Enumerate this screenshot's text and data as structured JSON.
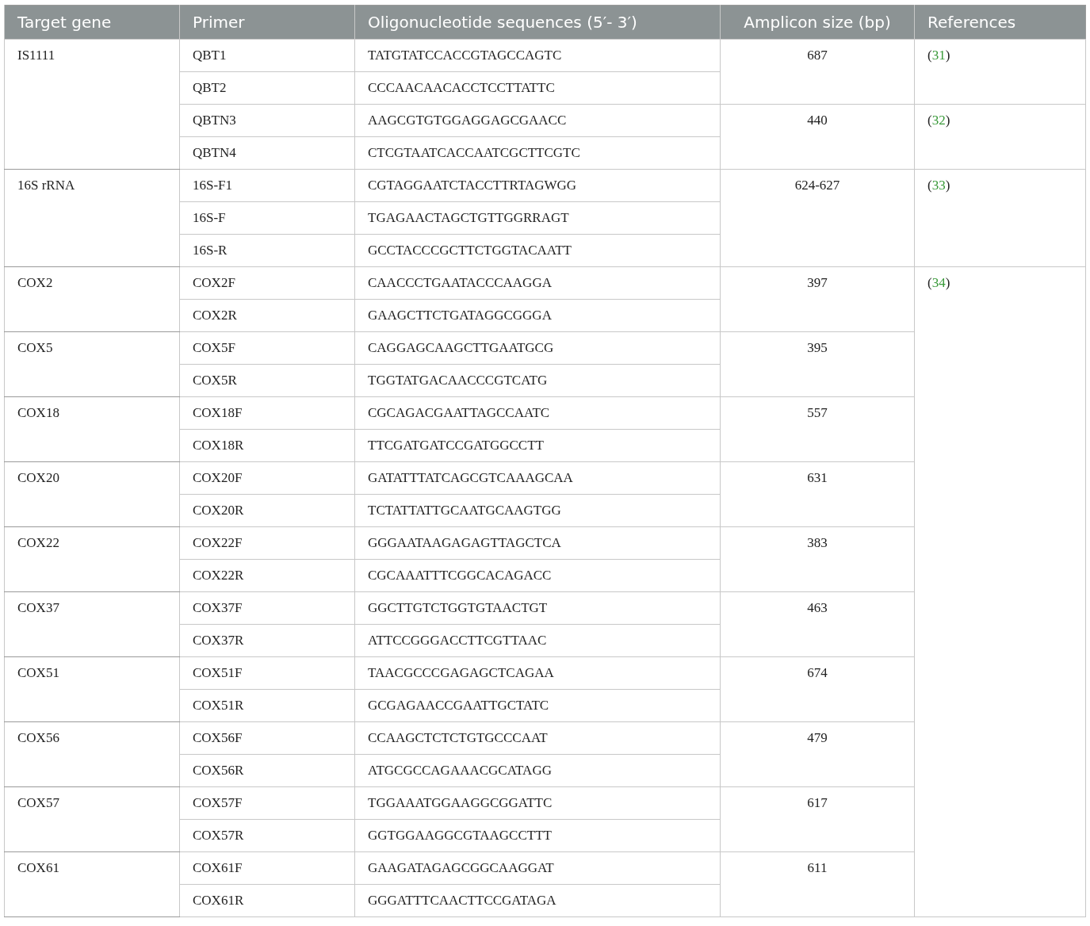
{
  "table": {
    "columns": [
      "Target gene",
      "Primer",
      "Oligonucleotide sequences (5′- 3′)",
      "Amplicon size (bp)",
      "References"
    ],
    "genes": [
      {
        "name": "IS1111",
        "amplicons": [
          {
            "size": "687",
            "reference": {
              "before": "(",
              "link": "31",
              "after": ")"
            },
            "primers": [
              {
                "name": "QBT1",
                "sequence": "TATGTATCCACCGTAGCCAGTC"
              },
              {
                "name": "QBT2",
                "sequence": "CCCAACAACACCTCCTTATTC"
              }
            ]
          },
          {
            "size": "440",
            "reference": {
              "before": "(",
              "link": "32",
              "after": ")"
            },
            "primers": [
              {
                "name": "QBTN3",
                "sequence": "AAGCGTGTGGAGGAGCGAACC"
              },
              {
                "name": "QBTN4",
                "sequence": "CTCGTAATCACCAATCGCTTCGTC"
              }
            ]
          }
        ]
      },
      {
        "name": "16S rRNA",
        "amplicons": [
          {
            "size": "624-627",
            "reference": {
              "before": "(",
              "link": "33",
              "after": ")"
            },
            "primers": [
              {
                "name": "16S-F1",
                "sequence": "CGTAGGAATCTACCTTRTAGWGG"
              },
              {
                "name": "16S-F",
                "sequence": "TGAGAACTAGCTGTTGGRRAGT"
              },
              {
                "name": "16S-R",
                "sequence": "GCCTACCCGCTTCTGGTACAATT"
              }
            ]
          }
        ]
      },
      {
        "name": "COX2",
        "amplicons": [
          {
            "size": "397",
            "reference": {
              "before": "(",
              "link": "34",
              "after": ")"
            },
            "primers": [
              {
                "name": "COX2F",
                "sequence": "CAACCCTGAATACCCAAGGA"
              },
              {
                "name": "COX2R",
                "sequence": "GAAGCTTCTGATAGGCGGGA"
              }
            ]
          }
        ]
      },
      {
        "name": "COX5",
        "amplicons": [
          {
            "size": "395",
            "primers": [
              {
                "name": "COX5F",
                "sequence": "CAGGAGCAAGCTTGAATGCG"
              },
              {
                "name": "COX5R",
                "sequence": "TGGTATGACAACCCGTCATG"
              }
            ]
          }
        ]
      },
      {
        "name": "COX18",
        "amplicons": [
          {
            "size": "557",
            "primers": [
              {
                "name": "COX18F",
                "sequence": "CGCAGACGAATTAGCCAATC"
              },
              {
                "name": "COX18R",
                "sequence": "TTCGATGATCCGATGGCCTT"
              }
            ]
          }
        ]
      },
      {
        "name": "COX20",
        "amplicons": [
          {
            "size": "631",
            "primers": [
              {
                "name": "COX20F",
                "sequence": "GATATTTATCAGCGTCAAAGCAA"
              },
              {
                "name": "COX20R",
                "sequence": "TCTATTATTGCAATGCAAGTGG"
              }
            ]
          }
        ]
      },
      {
        "name": "COX22",
        "amplicons": [
          {
            "size": "383",
            "primers": [
              {
                "name": "COX22F",
                "sequence": "GGGAATAAGAGAGTTAGCTCA"
              },
              {
                "name": "COX22R",
                "sequence": "CGCAAATTTCGGCACAGACC"
              }
            ]
          }
        ]
      },
      {
        "name": "COX37",
        "amplicons": [
          {
            "size": "463",
            "primers": [
              {
                "name": "COX37F",
                "sequence": "GGCTTGTCTGGTGTAACTGT"
              },
              {
                "name": "COX37R",
                "sequence": "ATTCCGGGACCTTCGTTAAC"
              }
            ]
          }
        ]
      },
      {
        "name": "COX51",
        "amplicons": [
          {
            "size": "674",
            "primers": [
              {
                "name": "COX51F",
                "sequence": "TAACGCCCGAGAGCTCAGAA"
              },
              {
                "name": "COX51R",
                "sequence": "GCGAGAACCGAATTGCTATC"
              }
            ]
          }
        ]
      },
      {
        "name": "COX56",
        "amplicons": [
          {
            "size": "479",
            "primers": [
              {
                "name": "COX56F",
                "sequence": "CCAAGCTCTCTGTGCCCAAT"
              },
              {
                "name": "COX56R",
                "sequence": "ATGCGCCAGAAACGCATAGG"
              }
            ]
          }
        ]
      },
      {
        "name": "COX57",
        "amplicons": [
          {
            "size": "617",
            "primers": [
              {
                "name": "COX57F",
                "sequence": "TGGAAATGGAAGGCGGATTC"
              },
              {
                "name": "COX57R",
                "sequence": "GGTGGAAGGCGTAAGCCTTT"
              }
            ]
          }
        ]
      },
      {
        "name": "COX61",
        "amplicons": [
          {
            "size": "611",
            "primers": [
              {
                "name": "COX61F",
                "sequence": "GAAGATAGAGCGGCAAGGAT"
              },
              {
                "name": "COX61R",
                "sequence": "GGGATTTCAACTTCCGATAGA"
              }
            ]
          }
        ]
      }
    ]
  }
}
